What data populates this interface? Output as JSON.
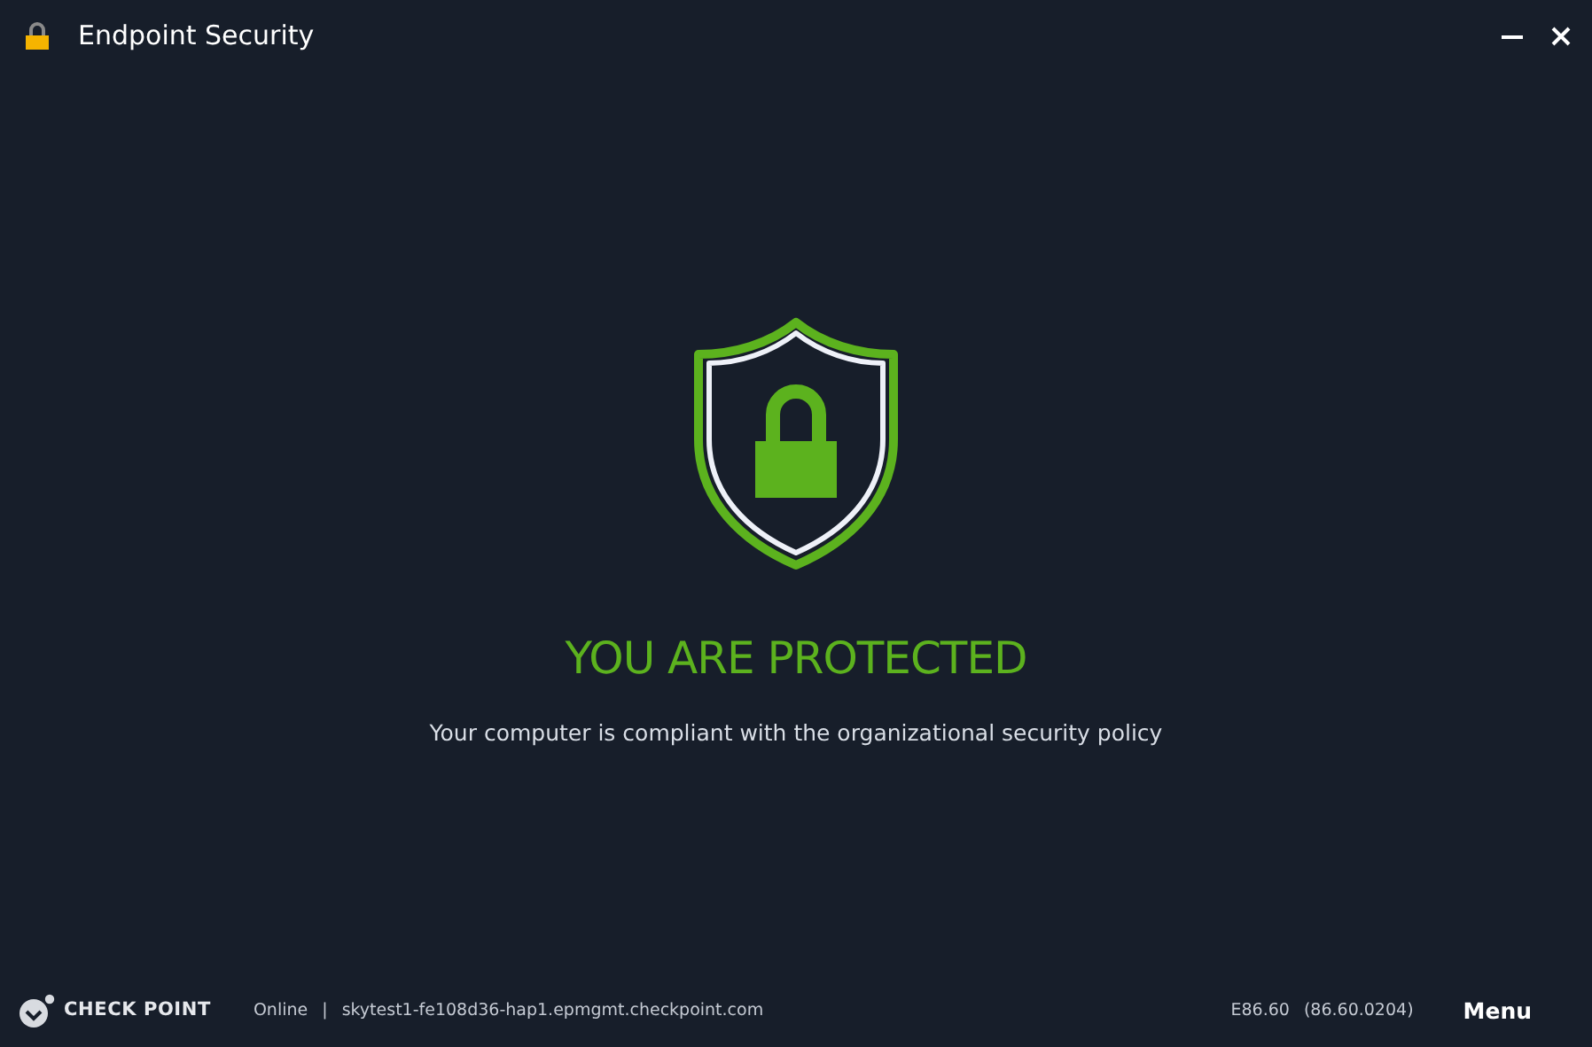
{
  "window": {
    "title": "Endpoint Security"
  },
  "status": {
    "protected": true,
    "heading": "YOU ARE PROTECTED",
    "message": "Your computer is compliant with the organizational security policy"
  },
  "footer": {
    "brand": "CHECK POINT",
    "connection": "Online",
    "separator": "|",
    "server": "skytest1-fe108d36-hap1.epmgmt.checkpoint.com",
    "version": "E86.60",
    "build": "(86.60.0204)",
    "menu": "Menu"
  }
}
